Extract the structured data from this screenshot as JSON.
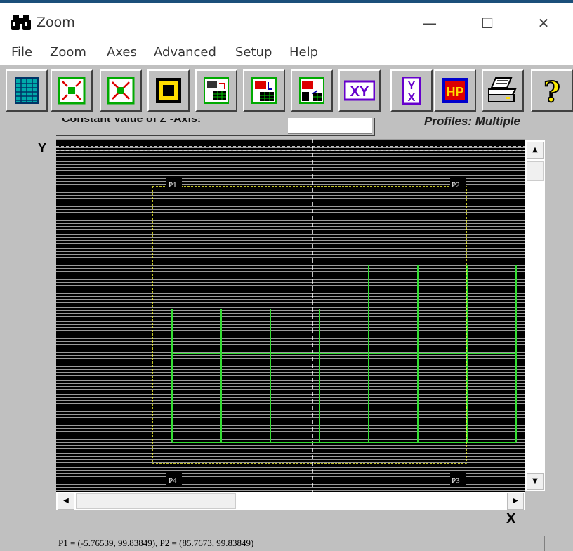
{
  "window": {
    "title": "Zoom",
    "minimize_glyph": "—",
    "maximize_glyph": "☐",
    "close_glyph": "✕"
  },
  "menu": [
    "File",
    "Zoom",
    "Axes",
    "Advanced",
    "Setup",
    "Help"
  ],
  "toolbar": {
    "icons": [
      "grid-icon",
      "zoom-in-icon",
      "zoom-out-icon",
      "frame-icon",
      "table-export-icon",
      "table-import-icon",
      "table-swap-icon",
      "xy-icon",
      "yx-icon",
      "hp-icon",
      "printer-icon",
      "help-icon"
    ],
    "xy_text": "XY",
    "yx_top": "Y",
    "yx_bottom": "X",
    "hp_text": "HP",
    "help_glyph": "?"
  },
  "header": {
    "constant_label": "Constant Value of Z -Axis:",
    "constant_value": "",
    "profiles_label": "Profiles: Multiple"
  },
  "plot": {
    "y_axis_label": "Y",
    "x_axis_label": "X",
    "points": [
      "P1",
      "P2",
      "P3",
      "P4"
    ],
    "colors": {
      "background_stripe_dark": "#000000",
      "background_stripe_light": "#9a9a9a",
      "zoom_box": "#ffff33",
      "profile_lines": "#33dd33",
      "center_line": "#ffffff"
    }
  },
  "status": {
    "text": "P1 = (-5.76539, 99.83849), P2 = (85.7673, 99.83849)"
  }
}
